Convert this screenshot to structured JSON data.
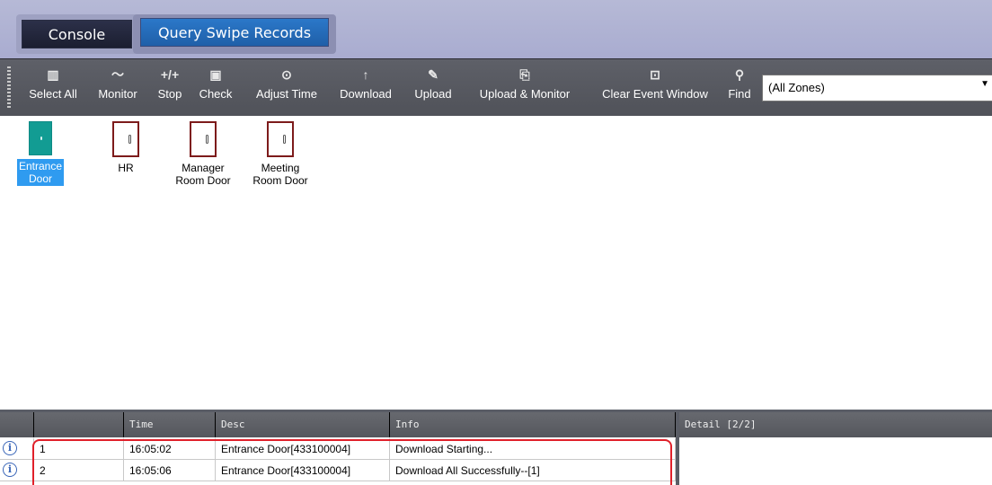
{
  "tabs": [
    {
      "label": "Console"
    },
    {
      "label": "Query Swipe Records"
    }
  ],
  "toolbar": {
    "buttons": [
      {
        "label": "Select All",
        "icon": "select-all-icon"
      },
      {
        "label": "Monitor",
        "icon": "monitor-icon"
      },
      {
        "label": "Stop",
        "icon": "stop-icon"
      },
      {
        "label": "Check",
        "icon": "check-icon"
      },
      {
        "label": "Adjust Time",
        "icon": "clock-icon"
      },
      {
        "label": "Download",
        "icon": "arrow-up-icon"
      },
      {
        "label": "Upload",
        "icon": "upload-icon"
      },
      {
        "label": "Upload & Monitor",
        "icon": "upload-monitor-icon"
      },
      {
        "label": "Clear Event Window",
        "icon": "trash-icon"
      },
      {
        "label": "Find",
        "icon": "search-icon"
      }
    ],
    "zones_value": "(All Zones)"
  },
  "doors": [
    {
      "label_line1": "Entrance",
      "label_line2": "Door",
      "selected": true
    },
    {
      "label_line1": "HR",
      "label_line2": ""
    },
    {
      "label_line1": "Manager",
      "label_line2": "Room Door"
    },
    {
      "label_line1": "Meeting",
      "label_line2": "Room Door"
    }
  ],
  "events": {
    "columns": [
      "",
      "",
      "Time",
      "Desc",
      "Info"
    ],
    "rows": [
      {
        "num": "1",
        "time": "16:05:02",
        "desc": "Entrance Door[433100004]",
        "info": "Download Starting..."
      },
      {
        "num": "2",
        "time": "16:05:06",
        "desc": "Entrance Door[433100004]",
        "info": "Download All Successfully--[1]"
      }
    ]
  },
  "detail": {
    "header": "Detail  [2/2]"
  },
  "colors": {
    "toolbar_bg": "#555860",
    "tabbar_bg": "#b0b3d4",
    "door_border": "#7d1b1b",
    "selected_door": "#129c93",
    "highlight": "#e0202a"
  }
}
